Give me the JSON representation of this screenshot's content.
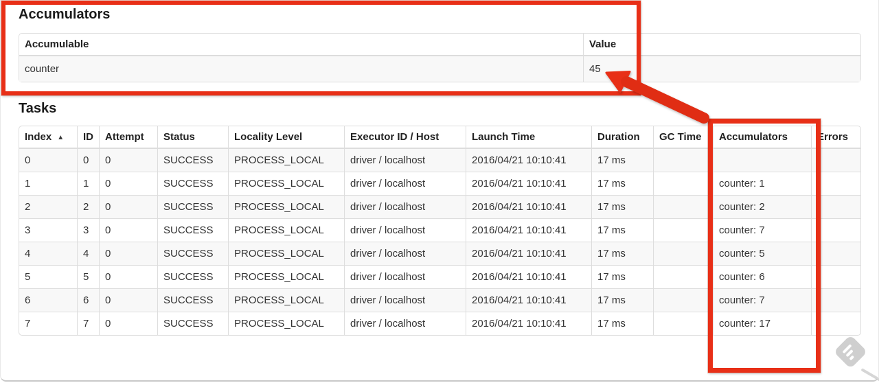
{
  "annotation": {
    "color": "#e82f17"
  },
  "accumulators_section": {
    "title": "Accumulators",
    "table": {
      "headers": [
        "Accumulable",
        "Value"
      ],
      "rows": [
        {
          "accumulable": "counter",
          "value": "45"
        }
      ]
    }
  },
  "tasks_section": {
    "title": "Tasks",
    "table": {
      "headers": [
        "Index",
        "ID",
        "Attempt",
        "Status",
        "Locality Level",
        "Executor ID / Host",
        "Launch Time",
        "Duration",
        "GC Time",
        "Accumulators",
        "Errors"
      ],
      "sort_icon": "▲",
      "rows": [
        {
          "index": "0",
          "id": "0",
          "attempt": "0",
          "status": "SUCCESS",
          "locality_level": "PROCESS_LOCAL",
          "executor": "driver / localhost",
          "launch_time": "2016/04/21 10:10:41",
          "duration": "17 ms",
          "gc_time": "",
          "accumulators": "",
          "errors": ""
        },
        {
          "index": "1",
          "id": "1",
          "attempt": "0",
          "status": "SUCCESS",
          "locality_level": "PROCESS_LOCAL",
          "executor": "driver / localhost",
          "launch_time": "2016/04/21 10:10:41",
          "duration": "17 ms",
          "gc_time": "",
          "accumulators": "counter: 1",
          "errors": ""
        },
        {
          "index": "2",
          "id": "2",
          "attempt": "0",
          "status": "SUCCESS",
          "locality_level": "PROCESS_LOCAL",
          "executor": "driver / localhost",
          "launch_time": "2016/04/21 10:10:41",
          "duration": "17 ms",
          "gc_time": "",
          "accumulators": "counter: 2",
          "errors": ""
        },
        {
          "index": "3",
          "id": "3",
          "attempt": "0",
          "status": "SUCCESS",
          "locality_level": "PROCESS_LOCAL",
          "executor": "driver / localhost",
          "launch_time": "2016/04/21 10:10:41",
          "duration": "17 ms",
          "gc_time": "",
          "accumulators": "counter: 7",
          "errors": ""
        },
        {
          "index": "4",
          "id": "4",
          "attempt": "0",
          "status": "SUCCESS",
          "locality_level": "PROCESS_LOCAL",
          "executor": "driver / localhost",
          "launch_time": "2016/04/21 10:10:41",
          "duration": "17 ms",
          "gc_time": "",
          "accumulators": "counter: 5",
          "errors": ""
        },
        {
          "index": "5",
          "id": "5",
          "attempt": "0",
          "status": "SUCCESS",
          "locality_level": "PROCESS_LOCAL",
          "executor": "driver / localhost",
          "launch_time": "2016/04/21 10:10:41",
          "duration": "17 ms",
          "gc_time": "",
          "accumulators": "counter: 6",
          "errors": ""
        },
        {
          "index": "6",
          "id": "6",
          "attempt": "0",
          "status": "SUCCESS",
          "locality_level": "PROCESS_LOCAL",
          "executor": "driver / localhost",
          "launch_time": "2016/04/21 10:10:41",
          "duration": "17 ms",
          "gc_time": "",
          "accumulators": "counter: 7",
          "errors": ""
        },
        {
          "index": "7",
          "id": "7",
          "attempt": "0",
          "status": "SUCCESS",
          "locality_level": "PROCESS_LOCAL",
          "executor": "driver / localhost",
          "launch_time": "2016/04/21 10:10:41",
          "duration": "17 ms",
          "gc_time": "",
          "accumulators": "counter: 17",
          "errors": ""
        }
      ]
    }
  },
  "watermark": {
    "icon": "skitch-stamp"
  }
}
